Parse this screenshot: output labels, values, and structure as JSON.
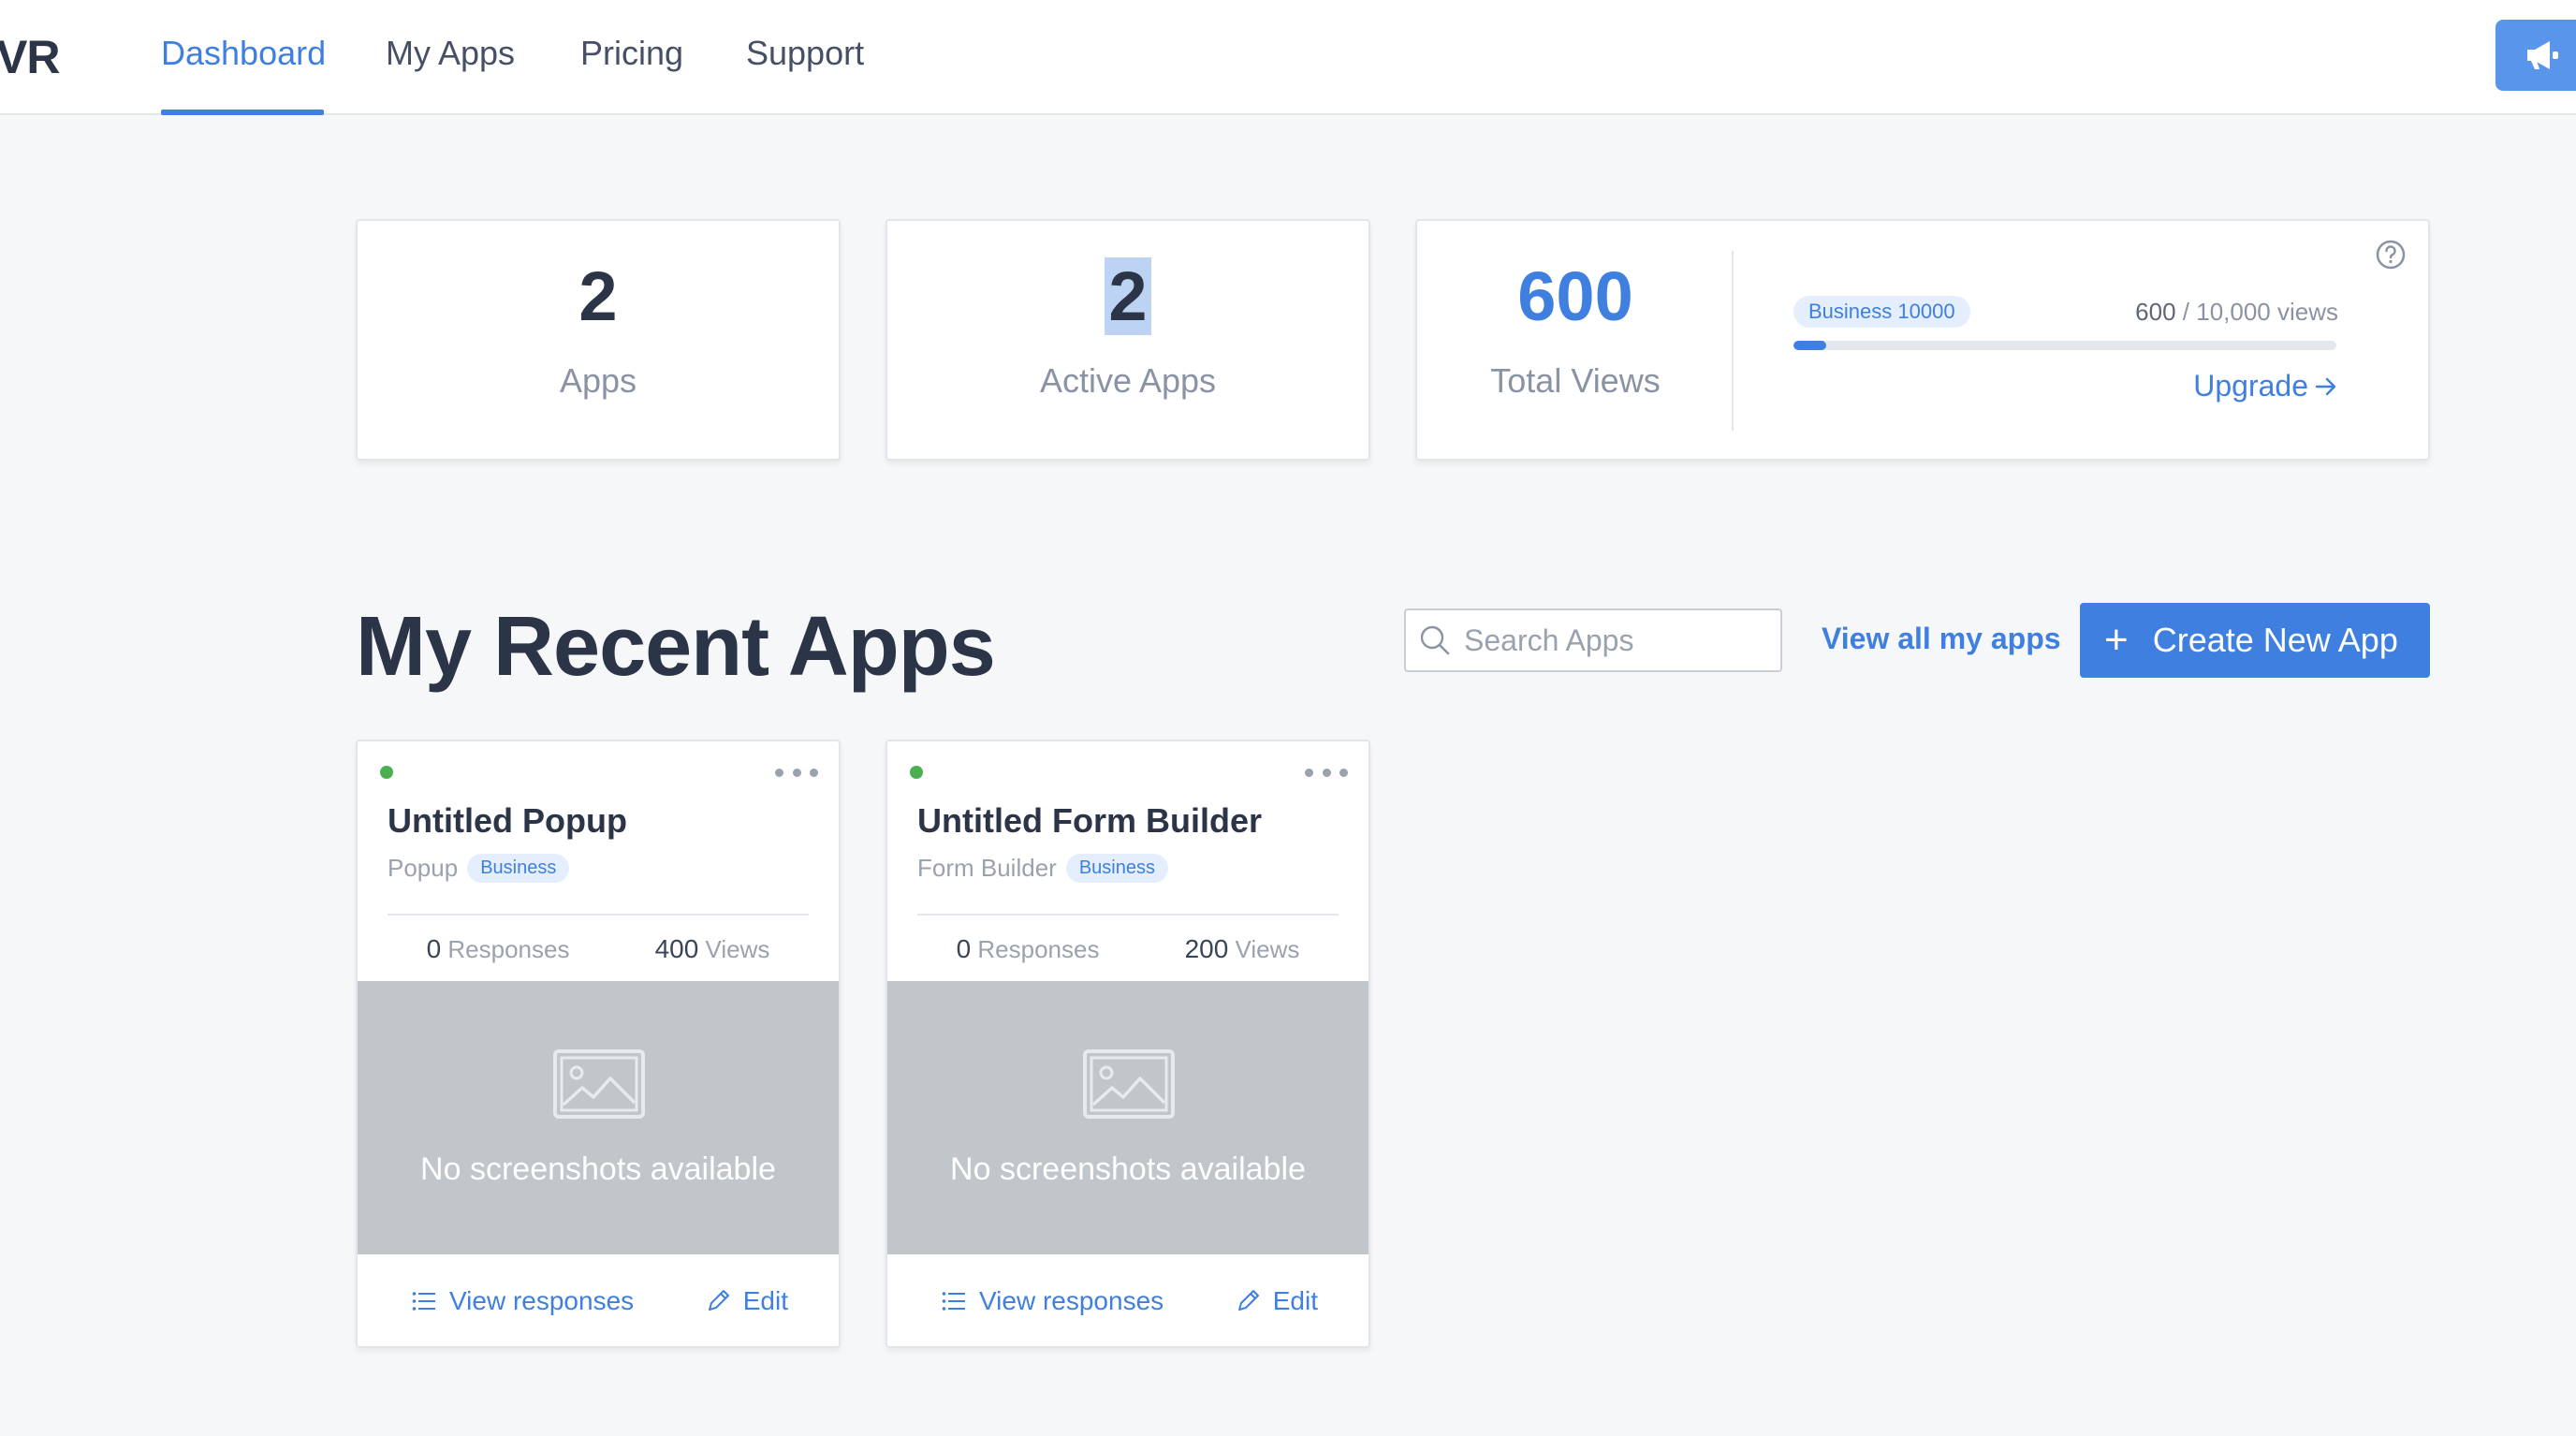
{
  "nav": {
    "logo": "VR",
    "tabs": [
      {
        "label": "Dashboard",
        "active": true
      },
      {
        "label": "My Apps",
        "active": false
      },
      {
        "label": "Pricing",
        "active": false
      },
      {
        "label": "Support",
        "active": false
      }
    ],
    "announce_icon": "megaphone-icon"
  },
  "stats": {
    "apps": {
      "value": "2",
      "label": "Apps"
    },
    "active_apps": {
      "value": "2",
      "label": "Active Apps"
    },
    "views": {
      "value": "600",
      "label": "Total Views",
      "plan": "Business 10000",
      "used": "600",
      "limit_text": " / 10,000 views",
      "usage_fraction": 0.06,
      "upgrade_label": "Upgrade",
      "help_icon": "question-circle-icon"
    }
  },
  "recent": {
    "title": "My Recent Apps",
    "search_placeholder": "Search Apps",
    "view_all": "View all my apps",
    "create_label": "Create New App",
    "apps": [
      {
        "title": "Untitled Popup",
        "type": "Popup",
        "plan": "Business",
        "responses": "0",
        "responses_label": "Responses",
        "views": "400",
        "views_label": "Views",
        "no_screenshot": "No screenshots available",
        "view_responses": "View responses",
        "edit": "Edit"
      },
      {
        "title": "Untitled Form Builder",
        "type": "Form Builder",
        "plan": "Business",
        "responses": "0",
        "responses_label": "Responses",
        "views": "200",
        "views_label": "Views",
        "no_screenshot": "No screenshots available",
        "view_responses": "View responses",
        "edit": "Edit"
      }
    ]
  },
  "colors": {
    "accent": "#3f7fe0",
    "status_active": "#4caf50",
    "screenshot_bg": "#c1c6ca"
  }
}
